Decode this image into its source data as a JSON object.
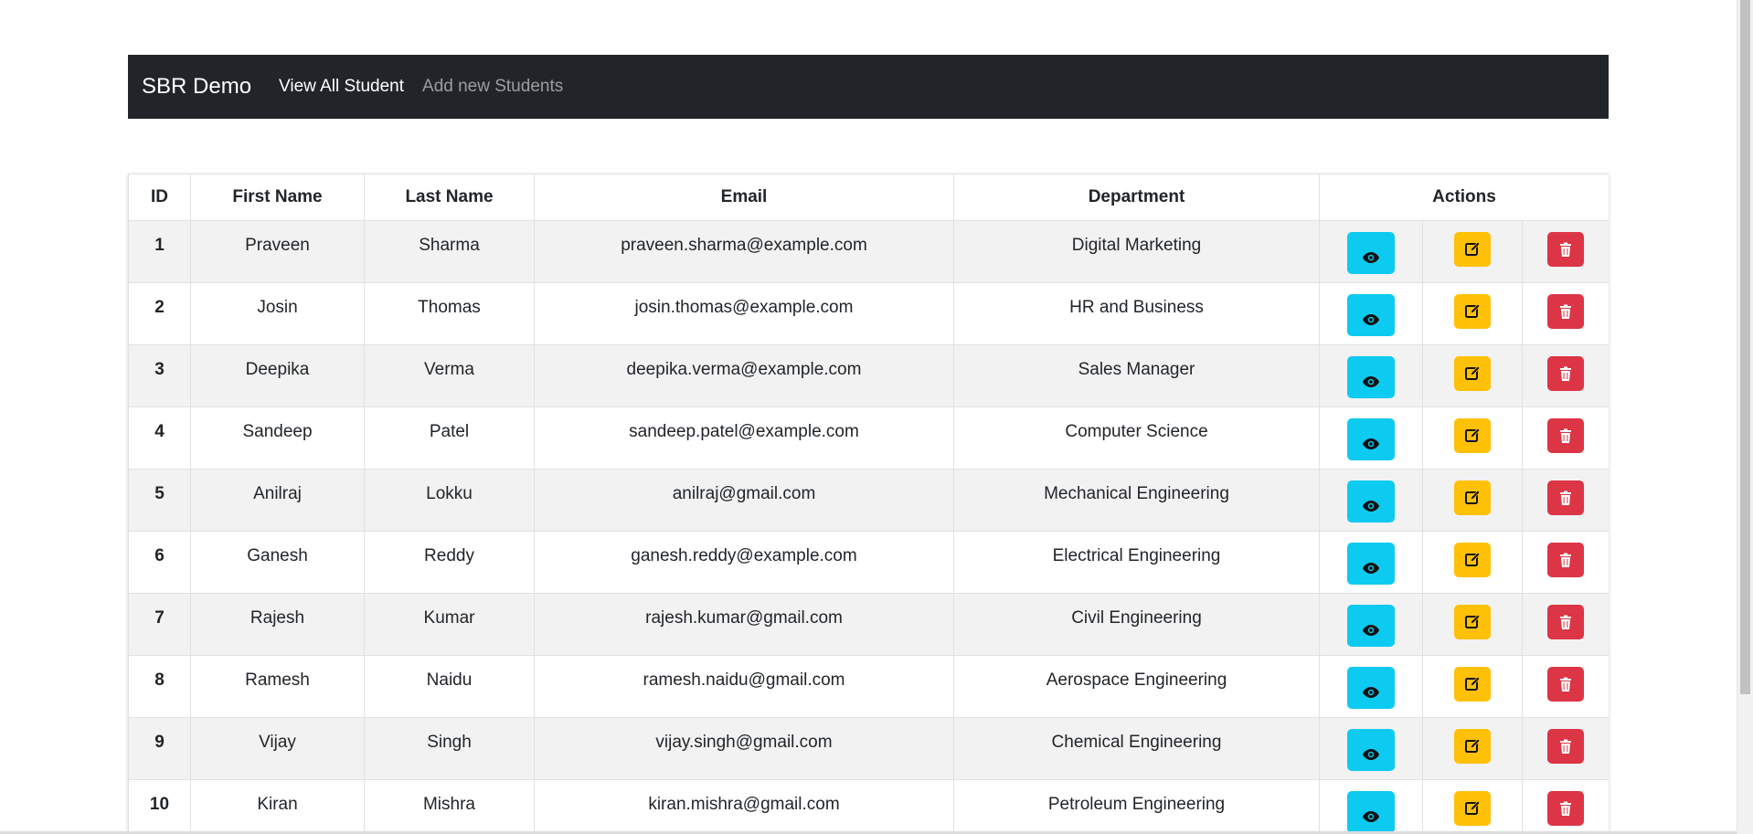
{
  "navbar": {
    "brand": "SBR Demo",
    "links": [
      {
        "label": "View All Student",
        "active": true
      },
      {
        "label": "Add new Students",
        "active": false
      }
    ]
  },
  "table": {
    "headers": {
      "id": "ID",
      "first_name": "First Name",
      "last_name": "Last Name",
      "email": "Email",
      "department": "Department",
      "actions": "Actions"
    },
    "rows": [
      {
        "id": "1",
        "first_name": "Praveen",
        "last_name": "Sharma",
        "email": "praveen.sharma@example.com",
        "department": "Digital Marketing"
      },
      {
        "id": "2",
        "first_name": "Josin",
        "last_name": "Thomas",
        "email": "josin.thomas@example.com",
        "department": "HR and Business"
      },
      {
        "id": "3",
        "first_name": "Deepika",
        "last_name": "Verma",
        "email": "deepika.verma@example.com",
        "department": "Sales Manager"
      },
      {
        "id": "4",
        "first_name": "Sandeep",
        "last_name": "Patel",
        "email": "sandeep.patel@example.com",
        "department": "Computer Science"
      },
      {
        "id": "5",
        "first_name": "Anilraj",
        "last_name": "Lokku",
        "email": "anilraj@gmail.com",
        "department": "Mechanical Engineering"
      },
      {
        "id": "6",
        "first_name": "Ganesh",
        "last_name": "Reddy",
        "email": "ganesh.reddy@example.com",
        "department": "Electrical Engineering"
      },
      {
        "id": "7",
        "first_name": "Rajesh",
        "last_name": "Kumar",
        "email": "rajesh.kumar@gmail.com",
        "department": "Civil Engineering"
      },
      {
        "id": "8",
        "first_name": "Ramesh",
        "last_name": "Naidu",
        "email": "ramesh.naidu@gmail.com",
        "department": "Aerospace Engineering"
      },
      {
        "id": "9",
        "first_name": "Vijay",
        "last_name": "Singh",
        "email": "vijay.singh@gmail.com",
        "department": "Chemical Engineering"
      },
      {
        "id": "10",
        "first_name": "Kiran",
        "last_name": "Mishra",
        "email": "kiran.mishra@gmail.com",
        "department": "Petroleum Engineering"
      }
    ]
  },
  "action_icons": {
    "view": "eye-icon",
    "edit": "edit-icon",
    "delete": "trash-icon"
  },
  "colors": {
    "navbar_bg": "#212529",
    "view_button": "#0dcaf0",
    "edit_button": "#ffc107",
    "delete_button": "#dc3545",
    "striped_row": "#f2f2f2"
  }
}
